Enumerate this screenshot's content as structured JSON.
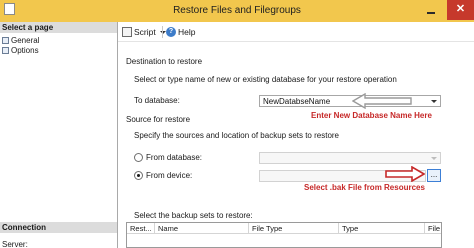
{
  "window": {
    "title": "Restore Files and Filegroups",
    "close_glyph": "✕"
  },
  "sidebar": {
    "header": "Select a page",
    "items": [
      {
        "label": "General",
        "icon": "page-icon"
      },
      {
        "label": "Options",
        "icon": "page-icon"
      }
    ],
    "connection_header": "Connection",
    "server_label": "Server:"
  },
  "toolbar": {
    "script_label": "Script",
    "help_label": "Help",
    "help_glyph": "?"
  },
  "destination": {
    "group_label": "Destination to restore",
    "description": "Select or type name of new or existing database for your restore operation",
    "database_label": "To database:",
    "database_value": "NewDatabseName"
  },
  "source": {
    "group_label": "Source for restore",
    "description": "Specify the sources and location of backup sets to restore",
    "from_database_label": "From database:",
    "from_database_selected": false,
    "from_device_label": "From device:",
    "from_device_selected": true,
    "from_device_value": "",
    "browse_label": "..."
  },
  "backup_sets": {
    "label": "Select the backup sets to restore:",
    "columns": [
      "Rest...",
      "Name",
      "File Type",
      "Type",
      "File L"
    ]
  },
  "annotations": {
    "database_hint": "Enter New Database Name Here",
    "device_hint": "Select .bak File from Resources",
    "hint_color": "#c62828"
  }
}
